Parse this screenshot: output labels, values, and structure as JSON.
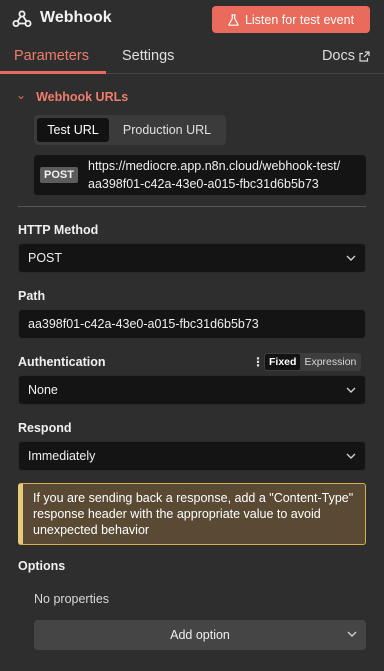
{
  "header": {
    "title": "Webhook",
    "listen_button": "Listen for test event"
  },
  "tabs": {
    "parameters": "Parameters",
    "settings": "Settings",
    "docs": "Docs"
  },
  "webhook_urls": {
    "section_label": "Webhook URLs",
    "toggle": {
      "test": "Test URL",
      "production": "Production URL",
      "selected": "Test URL"
    },
    "method_badge": "POST",
    "url_line1": "https://mediocre.app.n8n.cloud/webhook-test/",
    "url_line2": "aa398f01-c42a-43e0-a015-fbc31d6b5b73"
  },
  "fields": {
    "http_method": {
      "label": "HTTP Method",
      "value": "POST"
    },
    "path": {
      "label": "Path",
      "value": "aa398f01-c42a-43e0-a015-fbc31d6b5b73"
    },
    "authentication": {
      "label": "Authentication",
      "value": "None",
      "mode_fixed": "Fixed",
      "mode_expression": "Expression",
      "mode_selected": "Fixed"
    },
    "respond": {
      "label": "Respond",
      "value": "Immediately"
    }
  },
  "notice": "If you are sending back a response, add a \"Content-Type\" response header with the appropriate value to avoid unexpected behavior",
  "options": {
    "label": "Options",
    "empty_text": "No properties",
    "add_button": "Add option"
  },
  "colors": {
    "accent": "#ea6b5b",
    "background": "#2e2e2e",
    "field_bg": "#141414",
    "notice_bg": "#5a4a33",
    "notice_border": "#e8c97a"
  }
}
